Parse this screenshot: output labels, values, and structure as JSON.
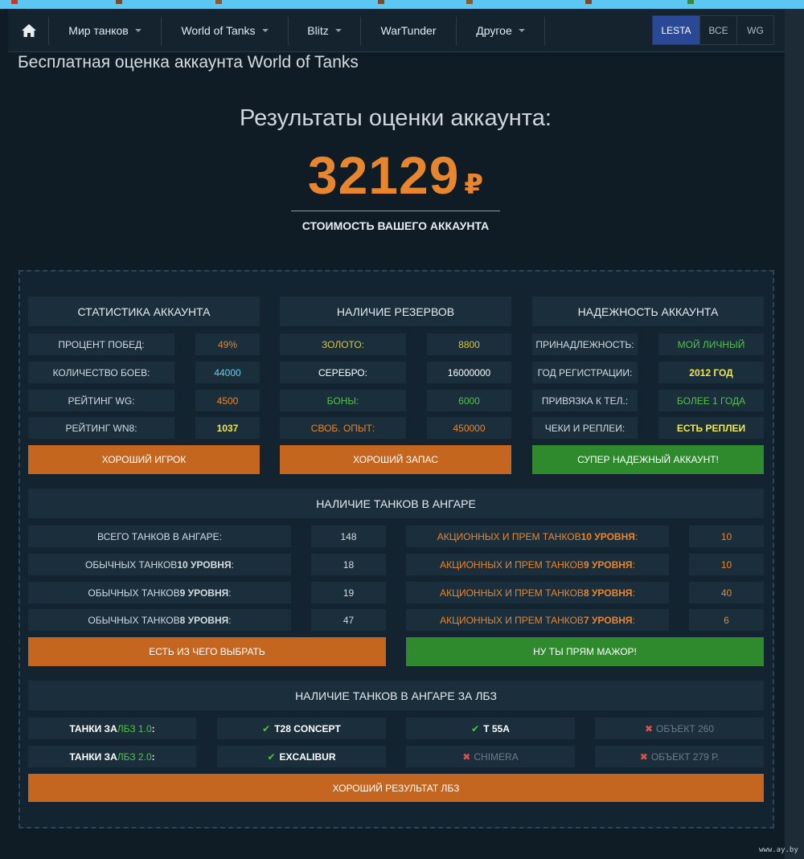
{
  "nav": {
    "items": [
      {
        "label": "Мир танков"
      },
      {
        "label": "World of Tanks"
      },
      {
        "label": "Blitz"
      },
      {
        "label": "WarTunder"
      },
      {
        "label": "Другое"
      }
    ],
    "regions": [
      {
        "label": "LESTA",
        "active": true
      },
      {
        "label": "ВСЕ",
        "active": false
      },
      {
        "label": "WG",
        "active": false
      }
    ]
  },
  "page": {
    "heading": "Бесплатная оценка аккаунта World of Tanks",
    "results_title": "Результаты оценки аккаунта:",
    "price_value": "32129",
    "price_currency": "₽",
    "price_caption": "СТОИМОСТЬ ВАШЕГО АККАУНТА"
  },
  "stats": {
    "title": "СТАТИСТИКА АККАУНТА",
    "rows": [
      {
        "label": "ПРОЦЕНТ ПОБЕД:",
        "value": "49%"
      },
      {
        "label": "КОЛИЧЕСТВО БОЕВ:",
        "value": "44000"
      },
      {
        "label": "РЕЙТИНГ WG:",
        "value": "4500"
      },
      {
        "label": "РЕЙТИНГ WN8:",
        "value": "1037"
      }
    ],
    "verdict": "ХОРОШИЙ ИГРОК"
  },
  "reserves": {
    "title": "НАЛИЧИЕ РЕЗЕРВОВ",
    "rows": [
      {
        "label": "ЗОЛОТО:",
        "value": "8800"
      },
      {
        "label": "СЕРЕБРО:",
        "value": "16000000"
      },
      {
        "label": "БОНЫ:",
        "value": "6000"
      },
      {
        "label": "СВОБ. ОПЫТ:",
        "value": "450000"
      }
    ],
    "verdict": "ХОРОШИЙ ЗАПАС"
  },
  "reliability": {
    "title": "НАДЕЖНОСТЬ АККАУНТА",
    "rows": [
      {
        "label": "ПРИНАДЛЕЖНОСТЬ:",
        "value": "МОЙ ЛИЧНЫЙ"
      },
      {
        "label": "ГОД РЕГИСТРАЦИИ:",
        "value": "2012 ГОД"
      },
      {
        "label": "ПРИВЯЗКА К ТЕЛ.:",
        "value": "БОЛЕЕ 1 ГОДА"
      },
      {
        "label": "ЧЕКИ И РЕПЛЕИ:",
        "value": "ЕСТЬ РЕПЛЕИ"
      }
    ],
    "verdict": "СУПЕР НАДЕЖНЫЙ АККАУНТ!"
  },
  "hangar": {
    "title": "НАЛИЧИЕ ТАНКОВ В АНГАРЕ",
    "left_rows": [
      {
        "label_pre": "ВСЕГО ТАНКОВ В АНГАРЕ:",
        "label_bold": "",
        "label_post": "",
        "value": "148"
      },
      {
        "label_pre": "ОБЫЧНЫХ ТАНКОВ ",
        "label_bold": "10 УРОВНЯ",
        "label_post": ":",
        "value": "18"
      },
      {
        "label_pre": "ОБЫЧНЫХ ТАНКОВ ",
        "label_bold": "9 УРОВНЯ",
        "label_post": ":",
        "value": "19"
      },
      {
        "label_pre": "ОБЫЧНЫХ ТАНКОВ ",
        "label_bold": "8 УРОВНЯ",
        "label_post": ":",
        "value": "47"
      }
    ],
    "right_rows": [
      {
        "label_pre": "АКЦИОННЫХ И ПРЕМ ТАНКОВ ",
        "label_bold": "10 УРОВНЯ",
        "label_post": ":",
        "value": "10"
      },
      {
        "label_pre": "АКЦИОННЫХ И ПРЕМ ТАНКОВ ",
        "label_bold": "9 УРОВНЯ",
        "label_post": ":",
        "value": "10"
      },
      {
        "label_pre": "АКЦИОННЫХ И ПРЕМ ТАНКОВ ",
        "label_bold": "8 УРОВНЯ",
        "label_post": ":",
        "value": "40"
      },
      {
        "label_pre": "АКЦИОННЫХ И ПРЕМ ТАНКОВ ",
        "label_bold": "7 УРОВНЯ",
        "label_post": ":",
        "value": "6"
      }
    ],
    "verdict_left": "ЕСТЬ ИЗ ЧЕГО ВЫБРАТЬ",
    "verdict_right": "НУ ТЫ ПРЯМ МАЖОР!"
  },
  "lbz": {
    "title": "НАЛИЧИЕ ТАНКОВ В АНГАРЕ ЗА ЛБЗ",
    "rows": [
      {
        "label_pre": "ТАНКИ ЗА ",
        "label_accent": "ЛБЗ 1.0",
        "label_post": " :",
        "tanks": [
          {
            "name": "T28 CONCEPT",
            "owned": true
          },
          {
            "name": "T 55A",
            "owned": true
          },
          {
            "name": "ОБЪЕКТ 260",
            "owned": false
          }
        ]
      },
      {
        "label_pre": "ТАНКИ ЗА ",
        "label_accent": "ЛБЗ 2.0",
        "label_post": " :",
        "tanks": [
          {
            "name": "EXCALIBUR",
            "owned": true
          },
          {
            "name": "CHIMERA",
            "owned": false
          },
          {
            "name": "ОБЪЕКТ 279 Р.",
            "owned": false
          }
        ]
      }
    ],
    "verdict": "ХОРОШИЙ РЕЗУЛЬТАТ ЛБЗ"
  },
  "watermark": "www.ay.by",
  "colors": {
    "accent_orange": "#e8862f",
    "button_orange": "#c4661f",
    "button_green": "#2e8a2c",
    "nav_active": "#2b4897"
  }
}
